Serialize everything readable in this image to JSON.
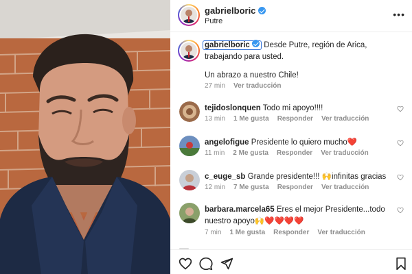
{
  "post": {
    "username": "gabrielboric",
    "location": "Putre"
  },
  "caption": {
    "username": "gabrielboric",
    "text": "Desde Putre, región de Arica, trabajando para usted.",
    "text2": "Un abrazo a nuestro Chile!",
    "time": "27 min",
    "translate": "Ver traducción"
  },
  "comments": [
    {
      "username": "tejidoslonquen",
      "text": "Todo mi apoyo!!!!",
      "time": "13 min",
      "likes": "1 Me gusta",
      "reply": "Responder",
      "translate": "Ver traducción"
    },
    {
      "username": "angelofigue",
      "text": "Presidente lo quiero mucho❤️",
      "time": "11 min",
      "likes": "2 Me gusta",
      "reply": "Responder",
      "translate": "Ver traducción"
    },
    {
      "username": "c_euge_sb",
      "text": "Grande presidente!!! 🙌infinitas gracias",
      "time": "12 min",
      "likes": "7 Me gusta",
      "reply": "Responder",
      "translate": "Ver traducción"
    },
    {
      "username": "barbara.marcela65",
      "text": "Eres el mejor Presidente...todo nuestro apoyo🙌❤️❤️❤️❤️",
      "time": "7 min",
      "likes": "1 Me gusta",
      "reply": "Responder",
      "translate": "Ver traducción"
    }
  ],
  "icons": {
    "more": "more-options-icon",
    "like": "heart-icon",
    "comment": "comment-icon",
    "share": "share-icon",
    "save": "bookmark-icon"
  },
  "colors": {
    "verified": "#3897f0",
    "link_text": "#262626",
    "muted": "#8e8e8e",
    "highlight_border": "#2f6fd6"
  }
}
